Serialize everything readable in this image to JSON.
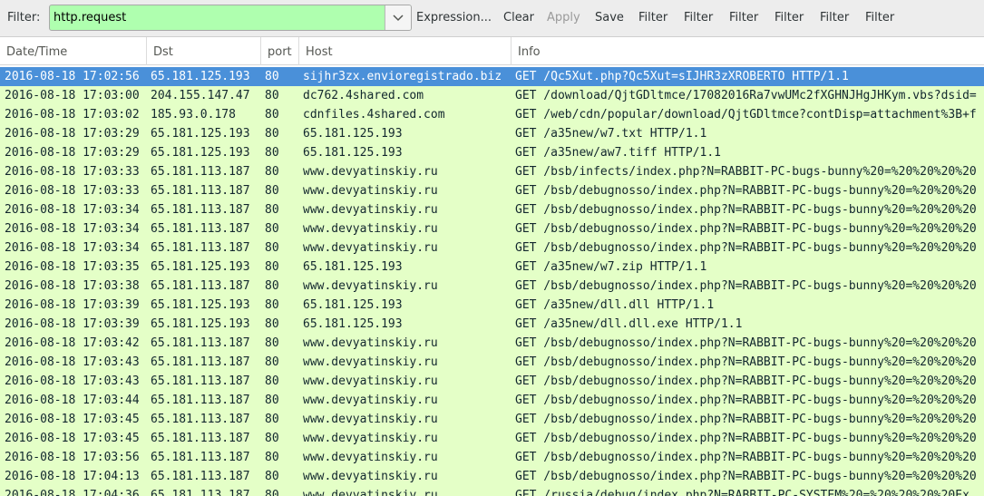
{
  "toolbar": {
    "filter_label": "Filter:",
    "filter_value": "http.request",
    "buttons": [
      "Expression...",
      "Clear",
      "Apply",
      "Save",
      "Filter",
      "Filter",
      "Filter",
      "Filter",
      "Filter",
      "Filter"
    ],
    "colors": {
      "filter_valid_bg": "#afffaf"
    }
  },
  "table": {
    "columns": [
      "Date/Time",
      "Dst",
      "port",
      "Host",
      "Info"
    ],
    "selected_row_index": 0,
    "colors": {
      "row_bg": "#e4ffc7",
      "selected_bg": "#4a90d9"
    },
    "rows": [
      [
        "2016-08-18 17:02:56",
        "65.181.125.193",
        "80",
        "sijhr3zx.envioregistrado.biz",
        "GET /Qc5Xut.php?Qc5Xut=sIJHR3zXROBERTO HTTP/1.1"
      ],
      [
        "2016-08-18 17:03:00",
        "204.155.147.47",
        "80",
        "dc762.4shared.com",
        "GET /download/QjtGDltmce/17082016Ra7vwUMc2fXGHNJHgJHKym.vbs?dsid="
      ],
      [
        "2016-08-18 17:03:02",
        "185.93.0.178",
        "80",
        "cdnfiles.4shared.com",
        "GET /web/cdn/popular/download/QjtGDltmce?contDisp=attachment%3B+f"
      ],
      [
        "2016-08-18 17:03:29",
        "65.181.125.193",
        "80",
        "65.181.125.193",
        "GET /a35new/w7.txt HTTP/1.1"
      ],
      [
        "2016-08-18 17:03:29",
        "65.181.125.193",
        "80",
        "65.181.125.193",
        "GET /a35new/aw7.tiff HTTP/1.1"
      ],
      [
        "2016-08-18 17:03:33",
        "65.181.113.187",
        "80",
        "www.devyatinskiy.ru",
        "GET /bsb/infects/index.php?N=RABBIT-PC-bugs-bunny%20=%20%20%20%20"
      ],
      [
        "2016-08-18 17:03:33",
        "65.181.113.187",
        "80",
        "www.devyatinskiy.ru",
        "GET /bsb/debugnosso/index.php?N=RABBIT-PC-bugs-bunny%20=%20%20%20"
      ],
      [
        "2016-08-18 17:03:34",
        "65.181.113.187",
        "80",
        "www.devyatinskiy.ru",
        "GET /bsb/debugnosso/index.php?N=RABBIT-PC-bugs-bunny%20=%20%20%20"
      ],
      [
        "2016-08-18 17:03:34",
        "65.181.113.187",
        "80",
        "www.devyatinskiy.ru",
        "GET /bsb/debugnosso/index.php?N=RABBIT-PC-bugs-bunny%20=%20%20%20"
      ],
      [
        "2016-08-18 17:03:34",
        "65.181.113.187",
        "80",
        "www.devyatinskiy.ru",
        "GET /bsb/debugnosso/index.php?N=RABBIT-PC-bugs-bunny%20=%20%20%20"
      ],
      [
        "2016-08-18 17:03:35",
        "65.181.125.193",
        "80",
        "65.181.125.193",
        "GET /a35new/w7.zip HTTP/1.1"
      ],
      [
        "2016-08-18 17:03:38",
        "65.181.113.187",
        "80",
        "www.devyatinskiy.ru",
        "GET /bsb/debugnosso/index.php?N=RABBIT-PC-bugs-bunny%20=%20%20%20"
      ],
      [
        "2016-08-18 17:03:39",
        "65.181.125.193",
        "80",
        "65.181.125.193",
        "GET /a35new/dll.dll HTTP/1.1"
      ],
      [
        "2016-08-18 17:03:39",
        "65.181.125.193",
        "80",
        "65.181.125.193",
        "GET /a35new/dll.dll.exe HTTP/1.1"
      ],
      [
        "2016-08-18 17:03:42",
        "65.181.113.187",
        "80",
        "www.devyatinskiy.ru",
        "GET /bsb/debugnosso/index.php?N=RABBIT-PC-bugs-bunny%20=%20%20%20"
      ],
      [
        "2016-08-18 17:03:43",
        "65.181.113.187",
        "80",
        "www.devyatinskiy.ru",
        "GET /bsb/debugnosso/index.php?N=RABBIT-PC-bugs-bunny%20=%20%20%20"
      ],
      [
        "2016-08-18 17:03:43",
        "65.181.113.187",
        "80",
        "www.devyatinskiy.ru",
        "GET /bsb/debugnosso/index.php?N=RABBIT-PC-bugs-bunny%20=%20%20%20"
      ],
      [
        "2016-08-18 17:03:44",
        "65.181.113.187",
        "80",
        "www.devyatinskiy.ru",
        "GET /bsb/debugnosso/index.php?N=RABBIT-PC-bugs-bunny%20=%20%20%20"
      ],
      [
        "2016-08-18 17:03:45",
        "65.181.113.187",
        "80",
        "www.devyatinskiy.ru",
        "GET /bsb/debugnosso/index.php?N=RABBIT-PC-bugs-bunny%20=%20%20%20"
      ],
      [
        "2016-08-18 17:03:45",
        "65.181.113.187",
        "80",
        "www.devyatinskiy.ru",
        "GET /bsb/debugnosso/index.php?N=RABBIT-PC-bugs-bunny%20=%20%20%20"
      ],
      [
        "2016-08-18 17:03:56",
        "65.181.113.187",
        "80",
        "www.devyatinskiy.ru",
        "GET /bsb/debugnosso/index.php?N=RABBIT-PC-bugs-bunny%20=%20%20%20"
      ],
      [
        "2016-08-18 17:04:13",
        "65.181.113.187",
        "80",
        "www.devyatinskiy.ru",
        "GET /bsb/debugnosso/index.php?N=RABBIT-PC-bugs-bunny%20=%20%20%20"
      ],
      [
        "2016-08-18 17:04:36",
        "65.181.113.187",
        "80",
        "www.devyatinskiy.ru",
        "GET /russia/debug/index.php?N=RABBIT-PC-SYSTEM%20=%20%20%20%20Ex"
      ]
    ]
  }
}
